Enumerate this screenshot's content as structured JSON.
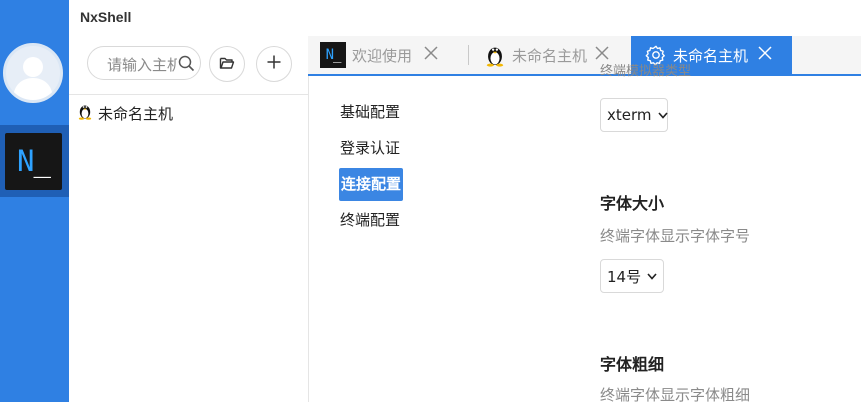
{
  "app": {
    "title": "NxShell"
  },
  "colors": {
    "accent": "#2f80e3",
    "rail": "#2f80e3",
    "logo_text": "#2ea2ff"
  },
  "rail": {
    "avatar_icon": "user-avatar-icon",
    "logo_text": "N",
    "logo_cursor": "_"
  },
  "host_panel": {
    "search_placeholder": "请输入主机",
    "search_icon": "search-icon",
    "folder_icon": "folder-icon",
    "add_icon": "plus-icon",
    "hosts": [
      {
        "label": "未命名主机",
        "icon": "linux-tux-icon"
      }
    ]
  },
  "tabs": [
    {
      "label": "欢迎使用",
      "icon": "nxshell-logo-icon",
      "active": false
    },
    {
      "label": "未命名主机",
      "icon": "linux-tux-icon",
      "active": false
    },
    {
      "label": "未命名主机",
      "icon": "gear-icon",
      "active": true
    }
  ],
  "settings": {
    "nav": [
      {
        "label": "基础配置",
        "active": false
      },
      {
        "label": "登录认证",
        "active": false
      },
      {
        "label": "连接配置",
        "active": true
      },
      {
        "label": "终端配置",
        "active": false
      }
    ],
    "truncated_desc": "终端模拟器类型",
    "terminal_type_value": "xterm",
    "font_size": {
      "title": "字体大小",
      "desc": "终端字体显示字体字号",
      "value": "14号"
    },
    "font_weight": {
      "title": "字体粗细",
      "desc": "终端字体显示字体粗细"
    }
  }
}
